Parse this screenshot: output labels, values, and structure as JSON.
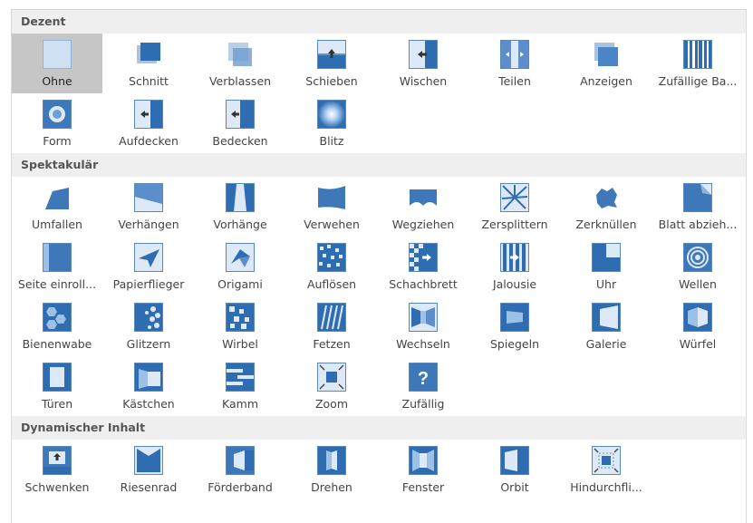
{
  "sections": [
    {
      "title": "Dezent",
      "rows": [
        [
          "Ohne",
          "Schnitt",
          "Verblassen",
          "Schieben",
          "Wischen",
          "Teilen",
          "Anzeigen",
          "Zufällige Ba..."
        ],
        [
          "Form",
          "Aufdecken",
          "Bedecken",
          "Blitz"
        ]
      ]
    },
    {
      "title": "Spektakulär",
      "rows": [
        [
          "Umfallen",
          "Verhängen",
          "Vorhänge",
          "Verwehen",
          "Wegziehen",
          "Zersplittern",
          "Zerknüllen",
          "Blatt abzieh..."
        ],
        [
          "Seite einroll...",
          "Papierflieger",
          "Origami",
          "Auflösen",
          "Schachbrett",
          "Jalousie",
          "Uhr",
          "Wellen"
        ],
        [
          "Bienenwabe",
          "Glitzern",
          "Wirbel",
          "Fetzen",
          "Wechseln",
          "Spiegeln",
          "Galerie",
          "Würfel"
        ],
        [
          "Türen",
          "Kästchen",
          "Kamm",
          "Zoom",
          "Zufällig"
        ]
      ]
    },
    {
      "title": "Dynamischer Inhalt",
      "rows": [
        [
          "Schwenken",
          "Riesenrad",
          "Förderband",
          "Drehen",
          "Fenster",
          "Orbit",
          "Hindurchfli..."
        ]
      ]
    }
  ],
  "selected": "Ohne",
  "colors": {
    "accent": "#4a86c5",
    "selected_bg": "#c6c6c6",
    "header_bg": "#efefef"
  }
}
